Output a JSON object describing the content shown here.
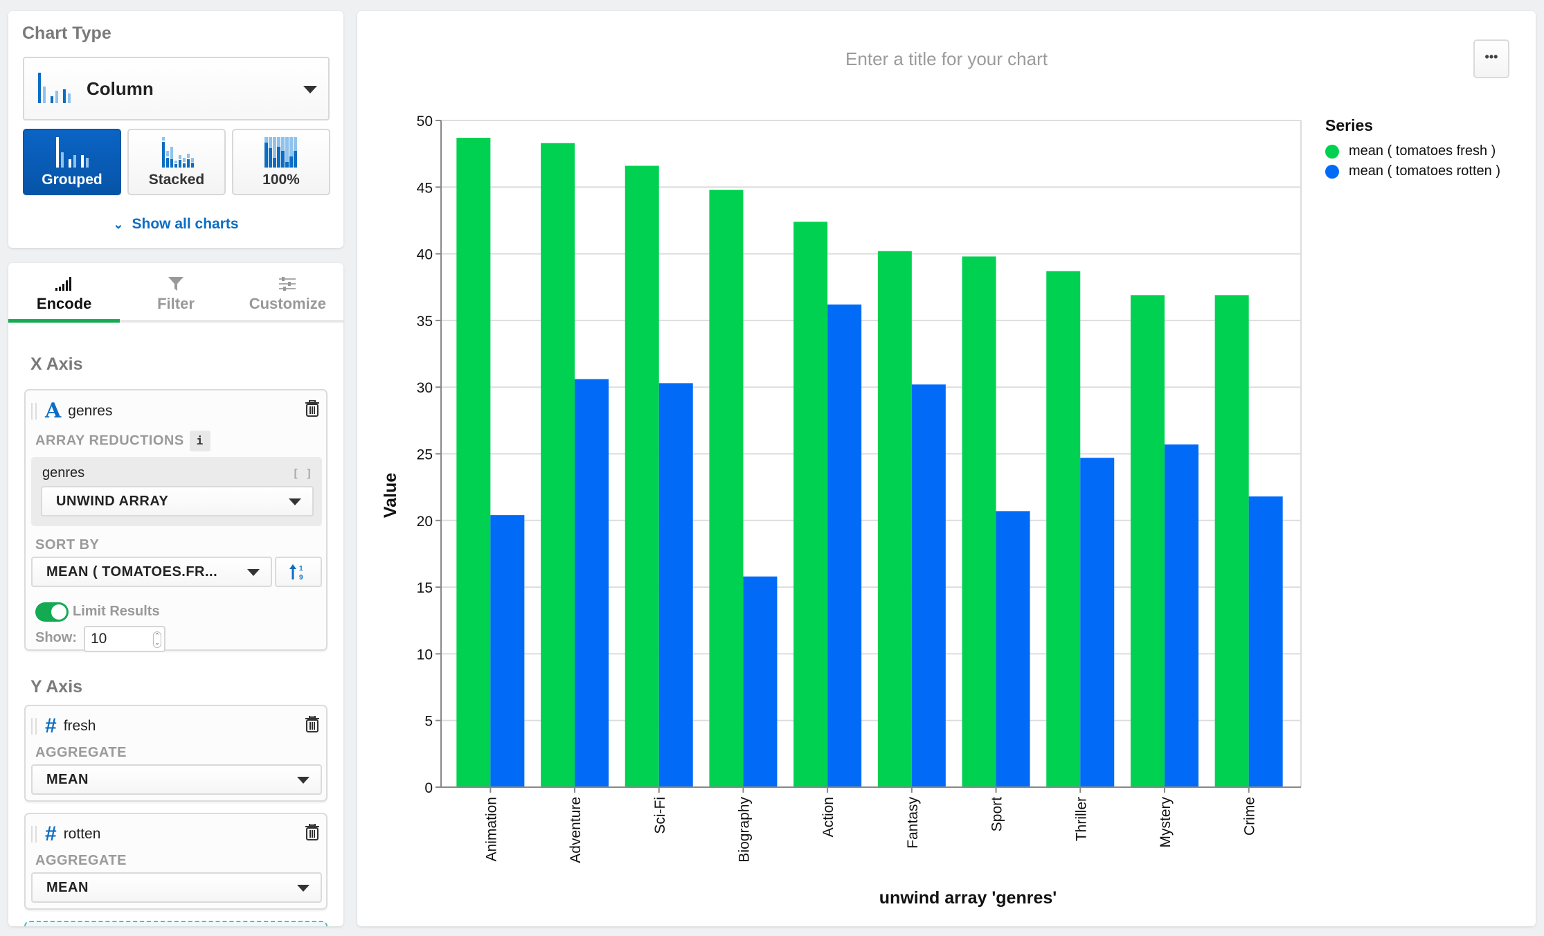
{
  "sidebar": {
    "chart_type_title": "Chart Type",
    "chart_type_selected": "Column",
    "variants": [
      {
        "label": "Grouped",
        "active": true
      },
      {
        "label": "Stacked",
        "active": false
      },
      {
        "label": "100%",
        "active": false
      }
    ],
    "show_all_label": "Show all charts",
    "tabs": [
      {
        "label": "Encode",
        "icon": "bar-signal-icon",
        "active": true
      },
      {
        "label": "Filter",
        "icon": "filter-icon",
        "active": false
      },
      {
        "label": "Customize",
        "icon": "sliders-icon",
        "active": false
      }
    ],
    "x_axis": {
      "title": "X Axis",
      "field_type_icon": "A",
      "field_name": "genres",
      "array_reductions_label": "ARRAY REDUCTIONS",
      "info_badge": "i",
      "reduction_field": "genres",
      "reduction_value": "UNWIND ARRAY",
      "sort_by_label": "SORT BY",
      "sort_by_value": "MEAN ( TOMATOES.FR...",
      "limit_results_label": "Limit Results",
      "limit_enabled": true,
      "show_label": "Show:",
      "show_value": "10"
    },
    "y_axis": {
      "title": "Y Axis",
      "fields": [
        {
          "type_icon": "#",
          "name": "fresh",
          "aggregate_label": "AGGREGATE",
          "aggregate_value": "MEAN"
        },
        {
          "type_icon": "#",
          "name": "rotten",
          "aggregate_label": "AGGREGATE",
          "aggregate_value": "MEAN"
        }
      ]
    }
  },
  "chart_panel": {
    "title_placeholder": "Enter a title for your chart",
    "more_label": "•••"
  },
  "colors": {
    "fresh": "#00d150",
    "rotten": "#016bf8",
    "accent": "#0654a7",
    "toggle_on": "#13aa52"
  },
  "chart_data": {
    "type": "bar",
    "title": "",
    "xlabel": "unwind array 'genres'",
    "ylabel": "Value",
    "ylim": [
      0,
      50
    ],
    "yticks": [
      0,
      5,
      10,
      15,
      20,
      25,
      30,
      35,
      40,
      45,
      50
    ],
    "grid": true,
    "legend_title": "Series",
    "legend_position": "top-right",
    "categories": [
      "Animation",
      "Adventure",
      "Sci-Fi",
      "Biography",
      "Action",
      "Fantasy",
      "Sport",
      "Thriller",
      "Mystery",
      "Crime"
    ],
    "series": [
      {
        "name": "mean ( tomatoes fresh )",
        "color": "#00d150",
        "values": [
          48.7,
          48.3,
          46.6,
          44.8,
          42.4,
          40.2,
          39.8,
          38.7,
          36.9,
          36.9
        ]
      },
      {
        "name": "mean ( tomatoes rotten )",
        "color": "#016bf8",
        "values": [
          20.4,
          30.6,
          30.3,
          15.8,
          36.2,
          30.2,
          20.7,
          24.7,
          25.7,
          21.8
        ]
      }
    ]
  }
}
